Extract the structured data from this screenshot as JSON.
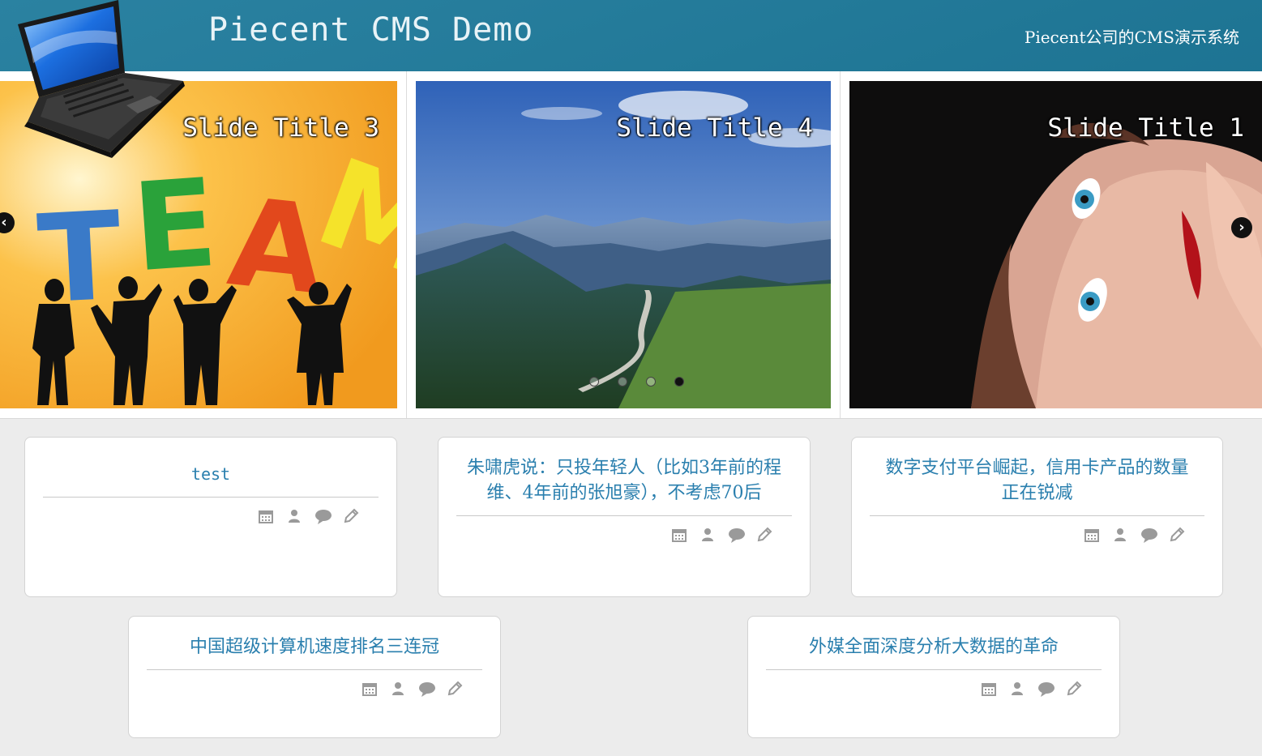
{
  "header": {
    "title": "Piecent CMS Demo",
    "subtitle": "Piecent公司的CMS演示系统",
    "logo_icon": "laptop-icon",
    "background_color": "#1f7b9c"
  },
  "slider": {
    "slides": [
      {
        "title": "Slide Title 3",
        "image": "team-silhouettes"
      },
      {
        "title": "Slide Title 4",
        "image": "mountain-valley-road"
      },
      {
        "title": "Slide Title 1",
        "image": "woman-face-portrait"
      }
    ],
    "prev_icon": "chevron-left-icon",
    "next_icon": "chevron-right-icon",
    "dot_count": 4,
    "active_dot": 4
  },
  "articles": [
    {
      "title": "test"
    },
    {
      "title": "朱啸虎说：只投年轻人（比如3年前的程维、4年前的张旭豪），不考虑70后"
    },
    {
      "title": "数字支付平台崛起，信用卡产品的数量正在锐减"
    },
    {
      "title": "中国超级计算机速度排名三连冠"
    },
    {
      "title": "外媒全面深度分析大数据的革命"
    }
  ],
  "meta_icons": [
    "calendar-icon",
    "user-icon",
    "comment-icon",
    "edit-icon"
  ],
  "colors": {
    "link": "#2a7fae",
    "icon": "#999999",
    "page_bg": "#ececec"
  }
}
